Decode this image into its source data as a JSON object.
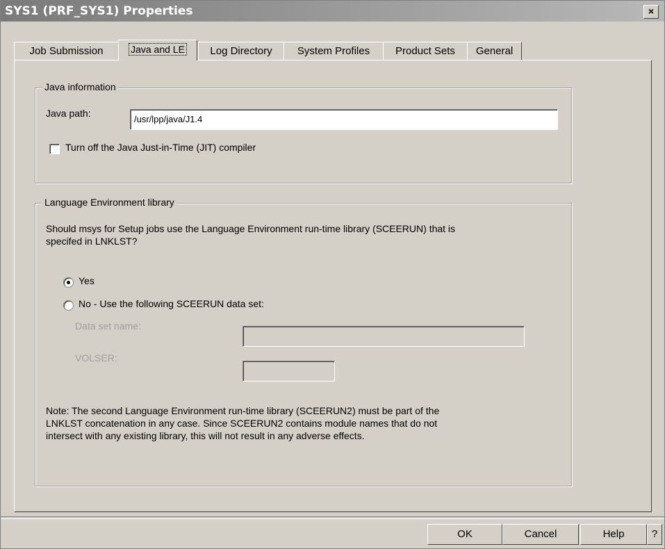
{
  "window": {
    "title": "SYS1 (PRF_SYS1) Properties",
    "close_label": "×"
  },
  "tabs": [
    {
      "label": "Job Submission"
    },
    {
      "label": "Java and LE"
    },
    {
      "label": "Log Directory"
    },
    {
      "label": "System Profiles"
    },
    {
      "label": "Product Sets"
    },
    {
      "label": "General"
    }
  ],
  "active_tab": "Java and LE",
  "java": {
    "legend": "Java information",
    "path_label": "Java path:",
    "path_value": "/usr/lpp/java/J1.4",
    "jit_label": "Turn off the Java Just-in-Time (JIT) compiler",
    "jit_checked": false
  },
  "le": {
    "legend": "Language Environment library",
    "question_line1": "Should msys for Setup jobs use the Language Environment run-time library (SCEERUN) that is",
    "question_line2": "specifed in LNKLST?",
    "yes_label": "Yes",
    "yes_selected": true,
    "no_label": "No - Use the following SCEERUN data set:",
    "dsn_label": "Data set name:",
    "dsn_value": "",
    "volser_label": "VOLSER:",
    "volser_value": "",
    "note_line1": "Note: The second Language Environment run-time library (SCEERUN2) must be part of the",
    "note_line2": "LNKLST concatenation in any case. Since SCEERUN2 contains module names that do not",
    "note_line3": "intersect with any existing library, this will not result in any adverse effects."
  },
  "buttons": {
    "ok": "OK",
    "cancel": "Cancel",
    "help": "Help",
    "question": "?"
  }
}
